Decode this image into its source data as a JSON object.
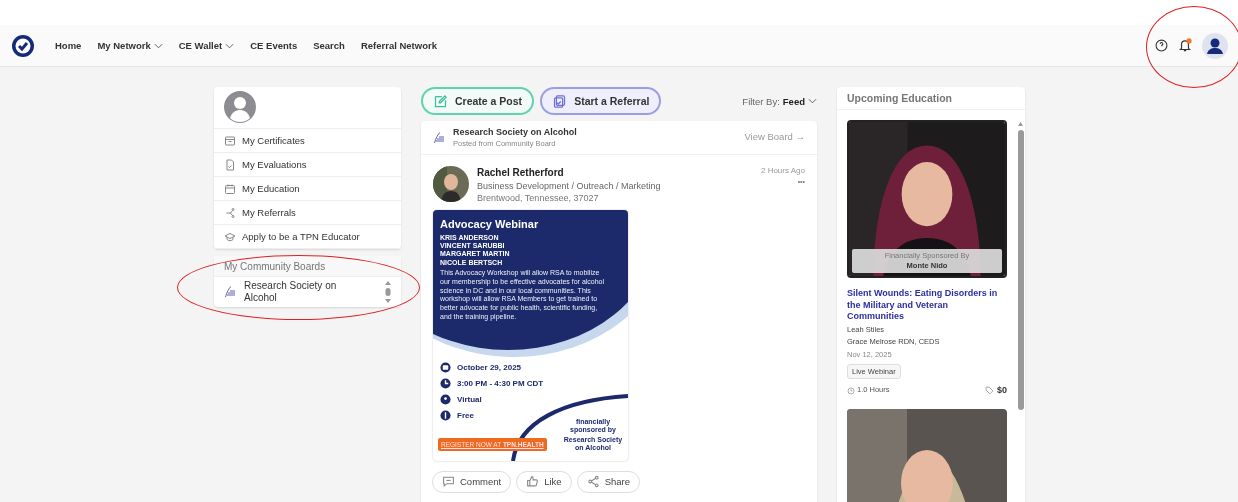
{
  "nav": {
    "items": [
      {
        "label": "Home",
        "dropdown": false
      },
      {
        "label": "My Network",
        "dropdown": true
      },
      {
        "label": "CE Wallet",
        "dropdown": true
      },
      {
        "label": "CE Events",
        "dropdown": false
      },
      {
        "label": "Search",
        "dropdown": false
      },
      {
        "label": "Referral Network",
        "dropdown": false
      }
    ],
    "notification_dot": true
  },
  "sidebar": {
    "items": [
      {
        "label": "My Certificates",
        "kind": "certificate"
      },
      {
        "label": "My Evaluations",
        "kind": "evaluation"
      },
      {
        "label": "My Education",
        "kind": "calendar"
      },
      {
        "label": "My Referrals",
        "kind": "referral"
      },
      {
        "label": "Apply to be a TPN Educator",
        "kind": "cap"
      }
    ],
    "boards_title": "My Community Boards",
    "boards": [
      {
        "label": "Research Society on Alcohol"
      }
    ]
  },
  "actions": [
    {
      "label": "Create a Post",
      "kind": "post"
    },
    {
      "label": "Start a Referral",
      "kind": "referral"
    }
  ],
  "filter": {
    "label": "Filter By:",
    "value": "Feed"
  },
  "post": {
    "board": "Research Society on Alcohol",
    "board_sub": "Posted from Community Board",
    "view_board": "View Board →",
    "author": "Rachel Retherford",
    "role": "Business Development / Outreach / Marketing",
    "location": "Brentwood, Tennessee, 37027",
    "time": "2 Hours Ago",
    "more": "•••",
    "flyer": {
      "title": "Advocacy Webinar",
      "names": [
        "KRIS ANDERSON",
        "VINCENT SARUBBI",
        "MARGARET MARTIN",
        "NICOLE BERTSCH"
      ],
      "body": "This Advocacy Workshop will allow RSA to mobilize our membership to be effective advocates for alcohol science in DC and in our local communities. This workshop will allow RSA Members to get trained to better advocate for public health, scientific funding, and the training pipeline.",
      "details": [
        {
          "kind": "date",
          "text": "October 29, 2025"
        },
        {
          "kind": "time",
          "text": "3:00 PM - 4:30 PM CDT"
        },
        {
          "kind": "place",
          "text": "Virtual"
        },
        {
          "kind": "price",
          "text": "Free"
        }
      ],
      "register": "REGISTER NOW AT **TPN.HEALTH**",
      "sponsor_label": "financially sponsored by",
      "sponsor": "Research Society on Alcohol"
    },
    "buttons": [
      {
        "label": "Comment",
        "kind": "comment"
      },
      {
        "label": "Like",
        "kind": "like"
      },
      {
        "label": "Share",
        "kind": "share"
      }
    ]
  },
  "education": {
    "title": "Upcoming Education",
    "items": [
      {
        "sponsor_label": "Financially Sponsored By",
        "sponsor": "Monte Nido",
        "title": "Silent Wounds: Eating Disorders in the Military and Veteran Communities",
        "presenters": [
          "Leah Stiles",
          "Grace Melrose RDN, CEDS"
        ],
        "date": "Nov 12, 2025",
        "tag": "Live Webinar",
        "hours": "1.0 Hours",
        "price": "$0"
      },
      {
        "kind": "picture"
      }
    ]
  }
}
